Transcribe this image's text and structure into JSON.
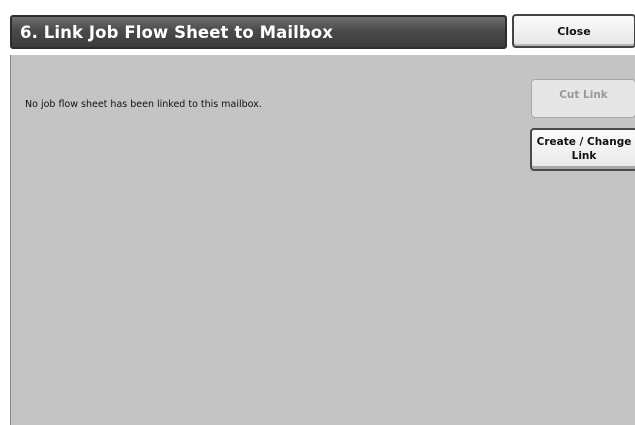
{
  "header": {
    "title": "6. Link Job Flow Sheet to Mailbox",
    "close_label": "Close"
  },
  "main": {
    "message": "No job flow sheet has been linked to this mailbox."
  },
  "actions": {
    "cut_link_label": "Cut Link",
    "cut_link_enabled": false,
    "create_change_link_label": "Create / Change Link"
  },
  "colors": {
    "title_bar": "#4a4a4a",
    "panel": "#c4c4c4",
    "disabled_text": "#9a9a9a"
  }
}
